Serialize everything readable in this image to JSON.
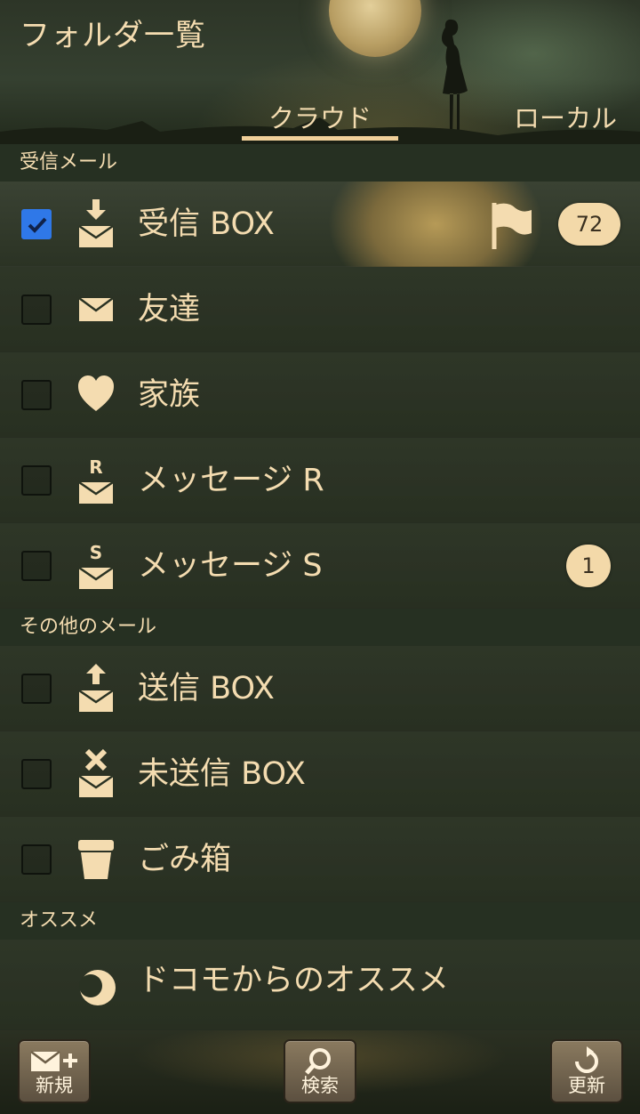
{
  "app_title": "フォルダ一覧",
  "tabs": {
    "cloud": "クラウド",
    "local": "ローカル",
    "active": "cloud"
  },
  "sections": {
    "inbox": "受信メール",
    "other": "その他のメール",
    "recommend": "オススメ"
  },
  "folders": [
    {
      "label": "受信 BOX",
      "icon": "inbox-download-icon",
      "checked": true,
      "flag": true,
      "badge": "72"
    },
    {
      "label": "友達",
      "icon": "envelope-icon",
      "checked": false
    },
    {
      "label": "家族",
      "icon": "heart-icon",
      "checked": false
    },
    {
      "label": "メッセージ R",
      "icon": "message-r-icon",
      "checked": false
    },
    {
      "label": "メッセージ S",
      "icon": "message-s-icon",
      "checked": false,
      "badge": "1"
    },
    {
      "label": "送信 BOX",
      "icon": "outbox-upload-icon",
      "checked": false
    },
    {
      "label": "未送信 BOX",
      "icon": "unsent-x-icon",
      "checked": false
    },
    {
      "label": "ごみ箱",
      "icon": "trash-icon",
      "checked": false
    }
  ],
  "recommend_item": {
    "label": "ドコモからのオススメ",
    "icon": "crescent-moon-icon"
  },
  "bottom_bar": {
    "new": "新規",
    "search": "検索",
    "refresh": "更新"
  },
  "colors": {
    "text": "#f4dcb0",
    "badge": "#f3d9a9",
    "checkbox_checked": "#2f78e8",
    "background": "#242a20"
  }
}
